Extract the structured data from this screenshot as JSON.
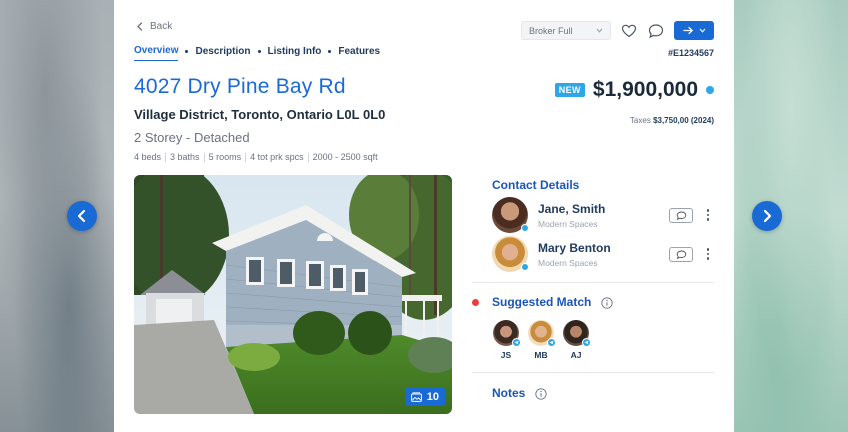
{
  "nav": {
    "back_label": "Back",
    "tabs": [
      {
        "label": "Overview"
      },
      {
        "label": "Description"
      },
      {
        "label": "Listing Info"
      },
      {
        "label": "Features"
      }
    ]
  },
  "toolbar": {
    "view_select": "Broker Full",
    "icons": [
      "heart-icon",
      "chat-icon",
      "share-icon"
    ]
  },
  "listing": {
    "mls_id": "#E1234567",
    "address": "4027 Dry Pine Bay Rd",
    "city": "Village District, Toronto, Ontario L0L 0L0",
    "style": "2 Storey - Detached",
    "facts": [
      "4 beds",
      "3 baths",
      "5 rooms",
      "4 tot prk spcs",
      "2000 - 2500 sqft"
    ],
    "badge": "NEW",
    "price": "$1,900,000",
    "taxes_label": "Taxes",
    "taxes_value": "$3,750,00 (2024)",
    "photo_count": "10"
  },
  "contacts": {
    "title": "Contact Details",
    "people": [
      {
        "name": "Jane, Smith",
        "company": "Modern Spaces"
      },
      {
        "name": "Mary Benton",
        "company": "Modern Spaces"
      }
    ]
  },
  "suggested": {
    "title": "Suggested Match",
    "matches": [
      {
        "initials": "JS"
      },
      {
        "initials": "MB"
      },
      {
        "initials": "AJ"
      }
    ]
  },
  "notes": {
    "title": "Notes"
  },
  "colors": {
    "accent": "#1a6ad6",
    "badge": "#2ea7e6",
    "alert": "#ef3b3b"
  }
}
